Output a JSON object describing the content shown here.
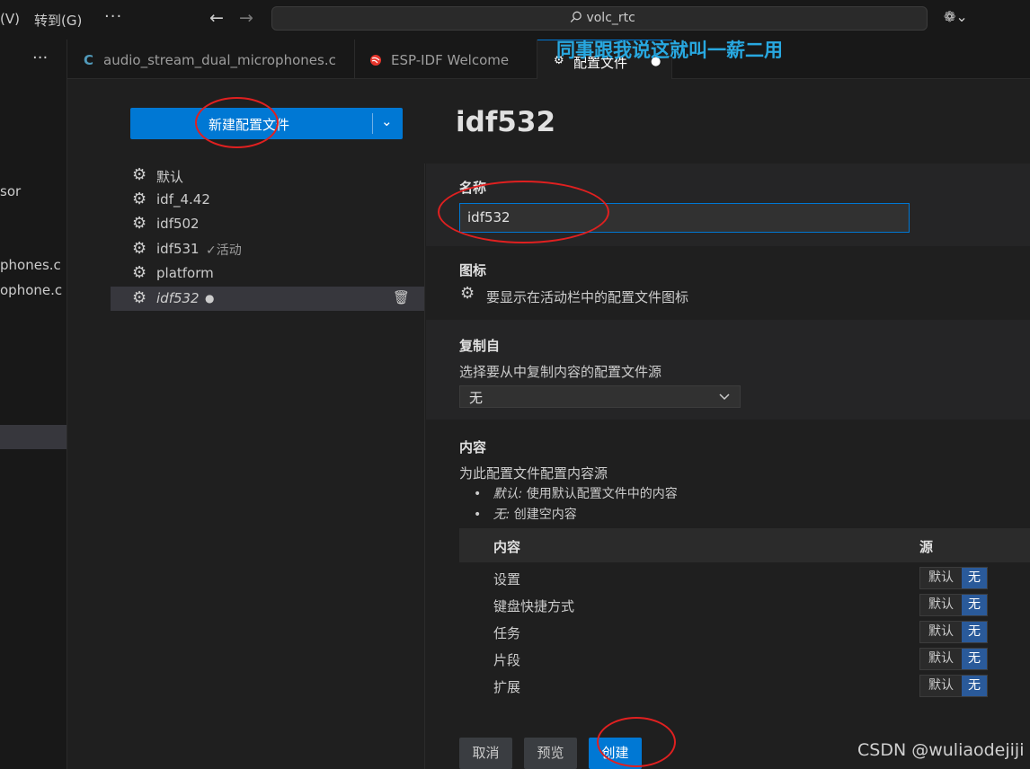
{
  "titlebar": {
    "menu_view": "(V)",
    "menu_goto": "转到(G)",
    "more": "···",
    "back": "←",
    "forward": "→",
    "search_text": "volc_rtc",
    "search_icon": "search-icon",
    "copilot": "❁⌄"
  },
  "sidebar": {
    "more": "···",
    "items": [
      "sor",
      "phones.c",
      "ophone.c"
    ]
  },
  "tabs": [
    {
      "icon": "C",
      "label": "audio_stream_dual_microphones.c"
    },
    {
      "icon": "esp-idf-icon",
      "label": "ESP-IDF Welcome"
    },
    {
      "icon": "settings-icon",
      "label": "配置文件",
      "dirty": "●"
    }
  ],
  "overlay_text": "同事跟我说这就叫一薪二用",
  "profiles": {
    "new_button": "新建配置文件",
    "new_dropdown": "⌄",
    "items": [
      {
        "name": "默认",
        "extra": ""
      },
      {
        "name": "idf_4.42",
        "extra": ""
      },
      {
        "name": "idf502",
        "extra": ""
      },
      {
        "name": "idf531",
        "extra": "✓活动"
      },
      {
        "name": "platform",
        "extra": ""
      },
      {
        "name": "idf532",
        "extra": "●"
      }
    ],
    "delete_icon": "🗑"
  },
  "editor": {
    "title": "idf532",
    "name_section": {
      "label": "名称",
      "value": "idf532"
    },
    "icon_section": {
      "label": "图标",
      "desc": "要显示在活动栏中的配置文件图标"
    },
    "copy_section": {
      "label": "复制自",
      "desc": "选择要从中复制内容的配置文件源",
      "value": "无"
    },
    "content_section": {
      "label": "内容",
      "desc": "为此配置文件配置内容源",
      "bullets": [
        {
          "term": "默认:",
          "text": " 使用默认配置文件中的内容"
        },
        {
          "term": "无:",
          "text": " 创建空内容"
        }
      ],
      "table": {
        "col_content": "内容",
        "col_source": "源",
        "rows": [
          {
            "label": "设置",
            "default": "默认",
            "none": "无"
          },
          {
            "label": "键盘快捷方式",
            "default": "默认",
            "none": "无"
          },
          {
            "label": "任务",
            "default": "默认",
            "none": "无"
          },
          {
            "label": "片段",
            "default": "默认",
            "none": "无"
          },
          {
            "label": "扩展",
            "default": "默认",
            "none": "无"
          }
        ]
      }
    },
    "buttons": {
      "cancel": "取消",
      "preview": "预览",
      "create": "创建"
    }
  },
  "watermark": "CSDN @wuliaodejiji",
  "colors": {
    "accent": "#0078d4",
    "annotation": "#e02020",
    "overlay": "#28a8e0"
  }
}
